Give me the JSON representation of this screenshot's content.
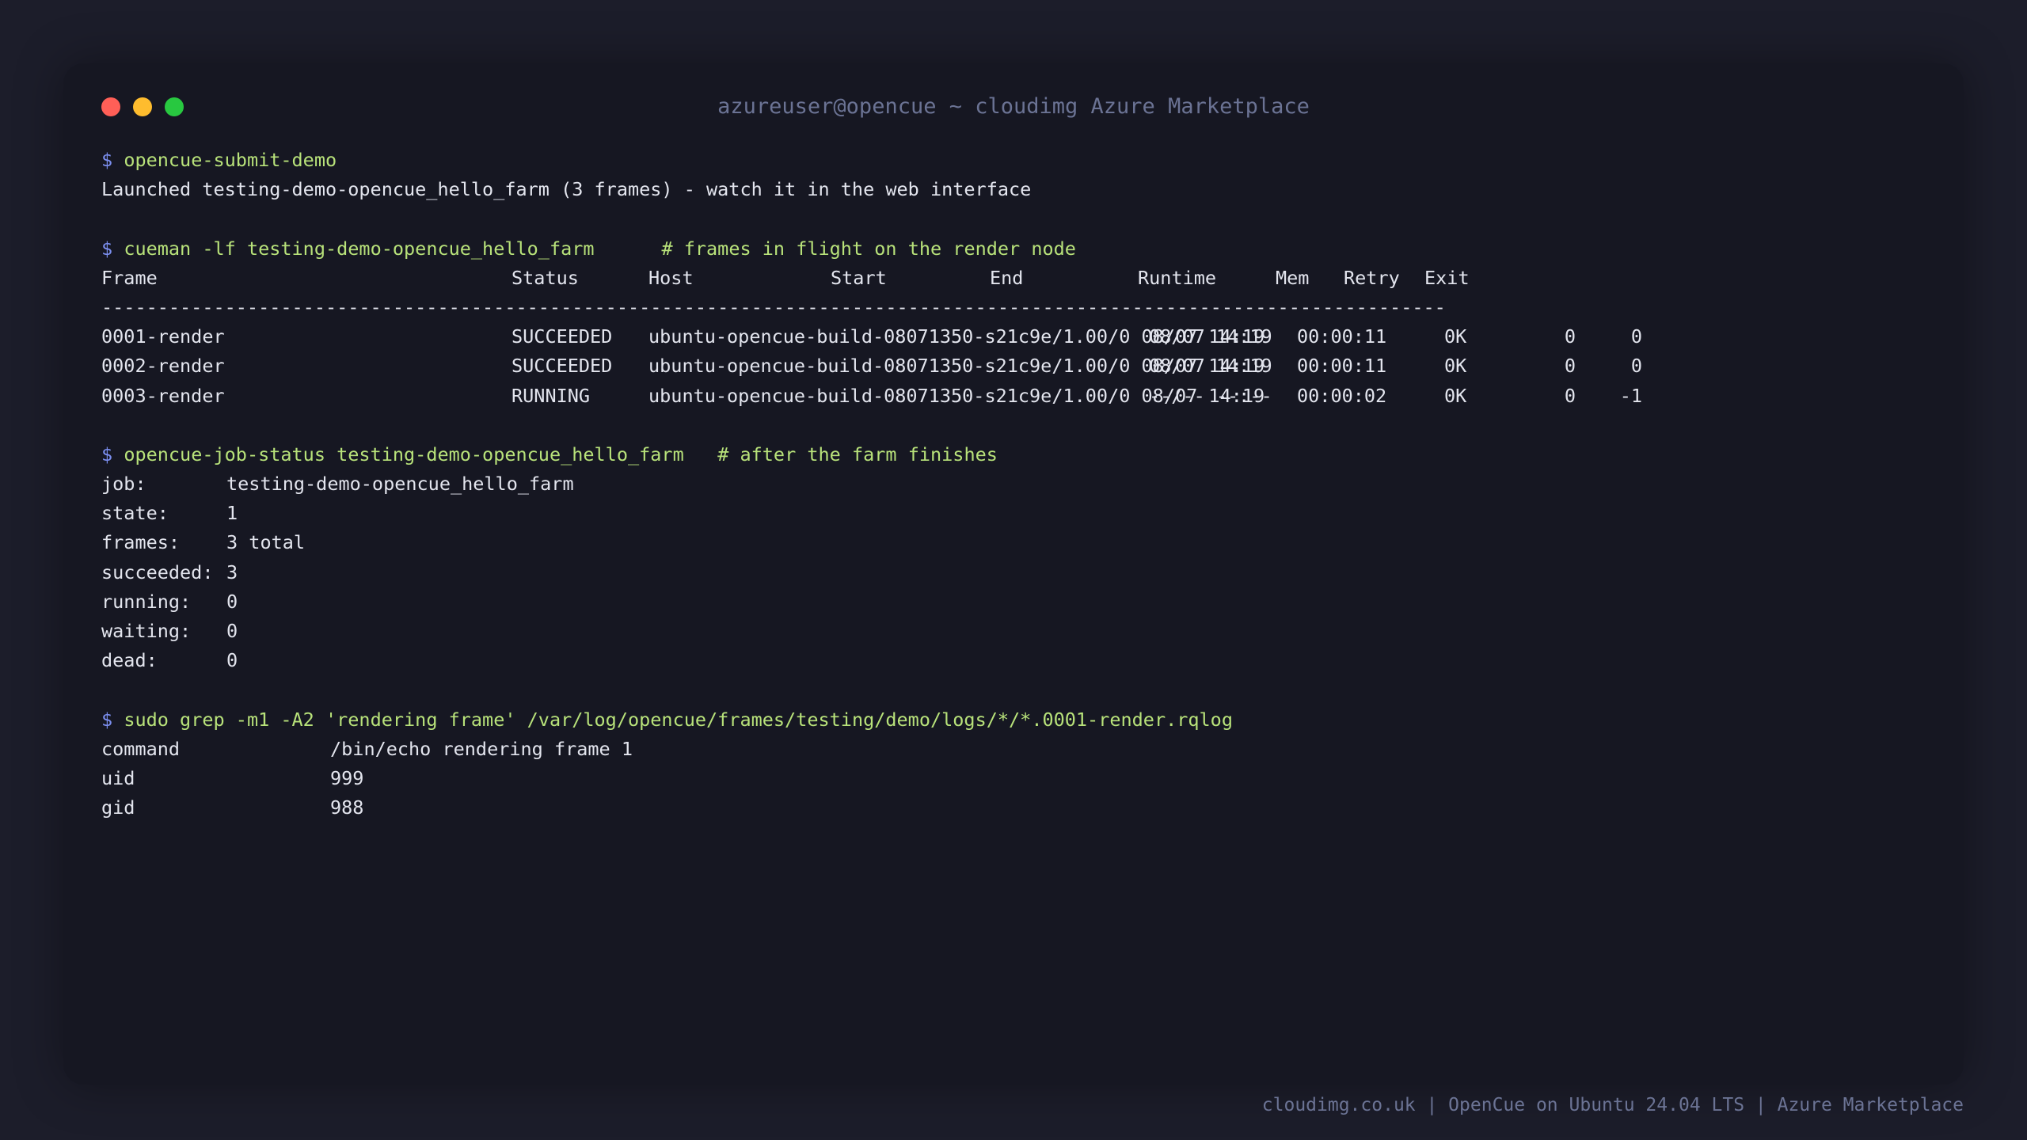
{
  "window": {
    "title": "azureuser@opencue ~ cloudimg Azure Marketplace"
  },
  "prompt_symbol": "$",
  "block1": {
    "command": "opencue-submit-demo",
    "output": "Launched testing-demo-opencue_hello_farm (3 frames) - watch it in the web interface"
  },
  "block2": {
    "command": "cueman -lf testing-demo-opencue_hello_farm",
    "comment": "# frames in flight on the render node",
    "headers": [
      "Frame",
      "Status",
      "Host",
      "Start",
      "End",
      "Runtime",
      "Mem",
      "Retry",
      "Exit"
    ],
    "separator": "------------------------------------------------------------------------------------------------------------------------",
    "rows": [
      {
        "frame": "0001-render",
        "status": "SUCCEEDED",
        "host": "ubuntu-opencue-build-08071350-s21c9e/1.00/0",
        "start": "08/07 14:19",
        "end": "08/07 14:19",
        "runtime": "00:00:11",
        "mem": "0K",
        "retry": "0",
        "exit": "0"
      },
      {
        "frame": "0002-render",
        "status": "SUCCEEDED",
        "host": "ubuntu-opencue-build-08071350-s21c9e/1.00/0",
        "start": "08/07 14:19",
        "end": "08/07 14:19",
        "runtime": "00:00:11",
        "mem": "0K",
        "retry": "0",
        "exit": "0"
      },
      {
        "frame": "0003-render",
        "status": "RUNNING",
        "host": "ubuntu-opencue-build-08071350-s21c9e/1.00/0",
        "start": "08/07 14:19",
        "end": "--/-- --:--",
        "runtime": "00:00:02",
        "mem": "0K",
        "retry": "0",
        "exit": "-1"
      }
    ]
  },
  "block3": {
    "command": "opencue-job-status testing-demo-opencue_hello_farm",
    "comment": "# after the farm finishes",
    "fields": [
      {
        "key": "job:",
        "value": "testing-demo-opencue_hello_farm"
      },
      {
        "key": "state:",
        "value": "1"
      },
      {
        "key": "frames:",
        "value": "3 total"
      },
      {
        "key": "succeeded:",
        "value": "3"
      },
      {
        "key": "running:",
        "value": "0"
      },
      {
        "key": "waiting:",
        "value": "0"
      },
      {
        "key": "dead:",
        "value": "0"
      }
    ]
  },
  "block4": {
    "command": "sudo grep -m1 -A2 'rendering frame' /var/log/opencue/frames/testing/demo/logs/*/*.0001-render.rqlog",
    "fields": [
      {
        "key": "command",
        "value": "/bin/echo rendering frame 1"
      },
      {
        "key": "uid",
        "value": "999"
      },
      {
        "key": "gid",
        "value": "988"
      }
    ]
  },
  "footer": "cloudimg.co.uk | OpenCue on Ubuntu 24.04 LTS | Azure Marketplace",
  "colors": {
    "background": "#1c1d2a",
    "window": "#161722",
    "prompt": "#7c8ff0",
    "command": "#b8e27a",
    "text": "#e3e5ee",
    "muted": "#6b7394",
    "close": "#ff5f57",
    "minimize": "#febc2e",
    "maximize": "#28c840"
  }
}
